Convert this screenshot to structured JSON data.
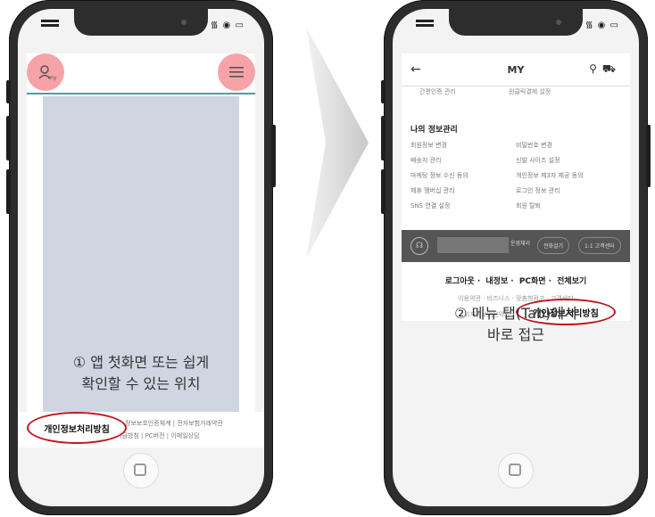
{
  "left_phone": {
    "status_icons": "᯾ ◉ ▭",
    "profile_sub": "my",
    "caption_line1": "① 앱 첫화면 또는 쉽게",
    "caption_line2": "확인할 수 있는 위치",
    "footer_links_line1": "정보보호인증체계  |  전자보험거래약관",
    "footer_links_line2": "기금방침  |  PC버전  |  이메일상담",
    "privacy_label": "개인정보처리방침"
  },
  "right_phone": {
    "status_icons": "᯾ ◉ ▭",
    "title": "MY",
    "cut_row": [
      "간편인증 관리",
      "원클릭결제 설정"
    ],
    "section_title": "나의 정보관리",
    "menu_items": [
      "회원정보 변경",
      "비밀번호 변경",
      "배송지 관리",
      "신발 사이즈 설정",
      "마케팅 정보 수신 동의",
      "개인정보 제3자 제공 동의",
      "제휴 멤버십 관리",
      "로그인 정보 관리",
      "SNS 연결 설정",
      "회원 탈퇴"
    ],
    "dark_band": {
      "label": "운영채리",
      "btn1": "전화걸기",
      "btn2": "1:1 고객센터"
    },
    "bottom_nav": [
      "로그아웃",
      "내정보",
      "PC화면",
      "전체보기"
    ],
    "sub_links": "이용약관 · 비즈니스 · 맞춤형광고 · 고객센터",
    "sub_links2": "위치정보이용약관",
    "privacy_label": "개인정보처리방침",
    "caption_line1": "② 메뉴 탭(Tab)에서",
    "caption_line2": "바로 접근"
  }
}
